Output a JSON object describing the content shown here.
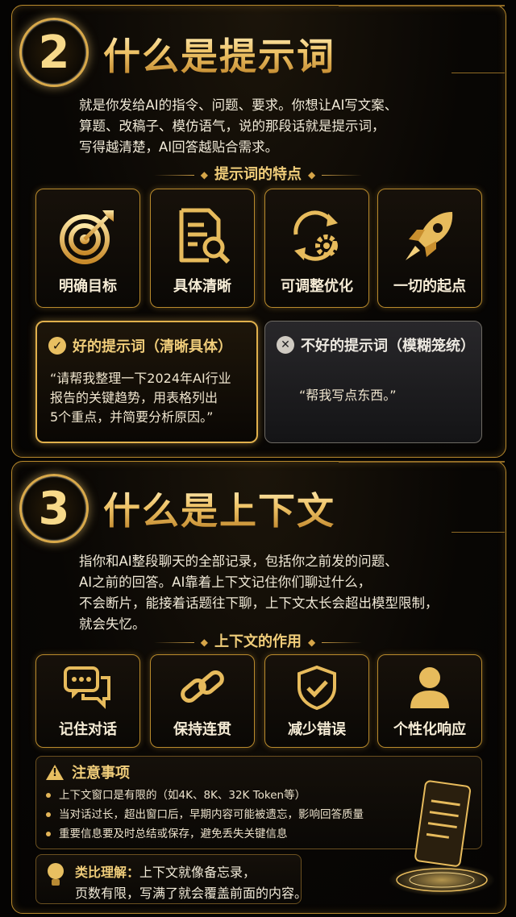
{
  "section2": {
    "number": "2",
    "title": "什么是提示词",
    "intro": [
      "就是你发给AI的指令、问题、要求。你想让AI写文案、",
      "算题、改稿子、模仿语气，说的那段话就是提示词，",
      "写得越清楚，AI回答越贴合需求。"
    ],
    "features_heading": "提示词的特点",
    "features": [
      {
        "label": "明确目标",
        "icon": "target-icon"
      },
      {
        "label": "具体清晰",
        "icon": "document-search-icon"
      },
      {
        "label": "可调整优化",
        "icon": "refresh-gear-icon"
      },
      {
        "label": "一切的起点",
        "icon": "rocket-icon"
      }
    ],
    "good": {
      "title": "好的提示词（清晰具体）",
      "quote": [
        "“请帮我整理一下2024年AI行业",
        "报告的关键趋势，用表格列出",
        "5个重点，并简要分析原因。”"
      ]
    },
    "bad": {
      "title": "不好的提示词（模糊笼统）",
      "quote": "“帮我写点东西。”"
    }
  },
  "section3": {
    "number": "3",
    "title": "什么是上下文",
    "intro": [
      "指你和AI整段聊天的全部记录，包括你之前发的问题、",
      "AI之前的回答。AI靠着上下文记住你们聊过什么，",
      "不会断片，能接着话题往下聊，上下文太长会超出模型限制，",
      "就会失忆。"
    ],
    "roles_heading": "上下文的作用",
    "roles": [
      {
        "label": "记住对话",
        "icon": "chat-bubbles-icon"
      },
      {
        "label": "保持连贯",
        "icon": "chain-link-icon"
      },
      {
        "label": "减少错误",
        "icon": "shield-check-icon"
      },
      {
        "label": "个性化响应",
        "icon": "user-icon"
      }
    ],
    "notice": {
      "title": "注意事项",
      "items": [
        "上下文窗口是有限的（如4K、8K、32K Token等）",
        "当对话过长，超出窗口后，早期内容可能被遗忘，影响回答质量",
        "重要信息要及时总结或保存，避免丢失关键信息"
      ]
    },
    "analogy": {
      "label": "类比理解：",
      "text1": "上下文就像备忘录，",
      "text2": "页数有限，写满了就会覆盖前面的内容。"
    }
  },
  "colors": {
    "gold": "#e9c36a",
    "bg": "#050403",
    "border": "#b98a2c"
  }
}
